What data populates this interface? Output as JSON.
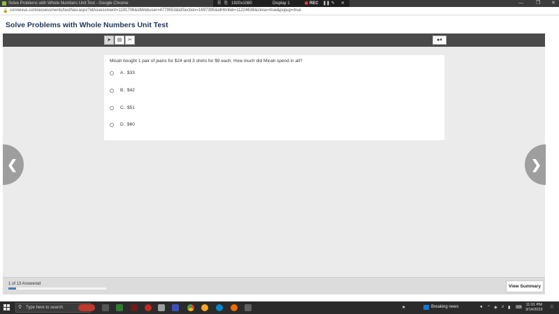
{
  "browser": {
    "window_title": "Solve Problems with Whole Numbers Unit Test - Google Chrome",
    "url": "connexus.com/assessments/testNav.aspx?idAssessment=1191706&idWebuser=4779553&idSection=1697395&idHtmllet=11224638&close=true&popup=true"
  },
  "recorder": {
    "resolution": "1920x1080",
    "display": "Display 1",
    "rec": "REC"
  },
  "app": {
    "title": "Solve Problems with Whole Numbers Unit Test"
  },
  "toolbar": {
    "tools": [
      "pointer-icon",
      "note-icon",
      "scissors-icon"
    ],
    "user_menu": "user-icon"
  },
  "question": {
    "text": "Micah bought 1 pair of jeans for $24 and 3 shirts for $9 each. How much did Micah spend in all?",
    "options": [
      {
        "letter": "A.",
        "value": "$33"
      },
      {
        "letter": "B.",
        "value": "$42"
      },
      {
        "letter": "C.",
        "value": "$51"
      },
      {
        "letter": "D.",
        "value": "$60"
      }
    ]
  },
  "footer": {
    "answered": "1 of 13 Answered",
    "progress": 0.077,
    "summary_label": "View Summary"
  },
  "taskbar": {
    "search_placeholder": "Type here to search",
    "news": "Breaking news",
    "time": "11:01 PM",
    "date": "3/14/2023"
  },
  "colors": {
    "header_title": "#1d3557",
    "toolbar": "#4a4a4a",
    "content_bg": "#ebebeb",
    "progress_fill": "#3f7fbf"
  }
}
